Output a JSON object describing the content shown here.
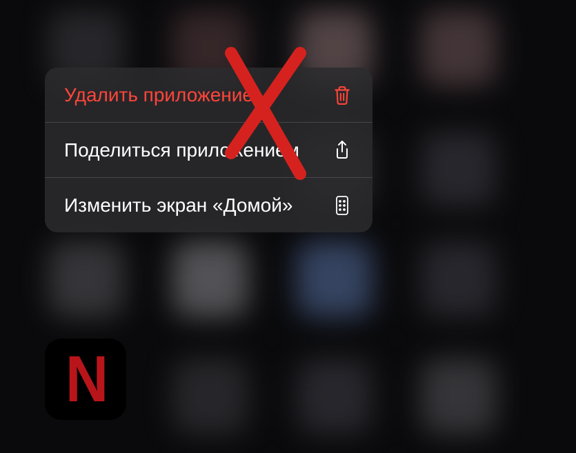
{
  "menu": {
    "items": [
      {
        "label": "Удалить приложение",
        "icon": "trash",
        "destructive": true
      },
      {
        "label": "Поделиться приложением",
        "icon": "share",
        "destructive": false
      },
      {
        "label": "Изменить экран «Домой»",
        "icon": "apps",
        "destructive": false
      }
    ]
  },
  "app": {
    "name": "Netflix",
    "letter": "N"
  },
  "colors": {
    "destructive": "#ff453a",
    "text": "#ffffff",
    "menu_bg": "rgba(44,44,46,0.85)",
    "netflix_red": "#b8151b"
  }
}
